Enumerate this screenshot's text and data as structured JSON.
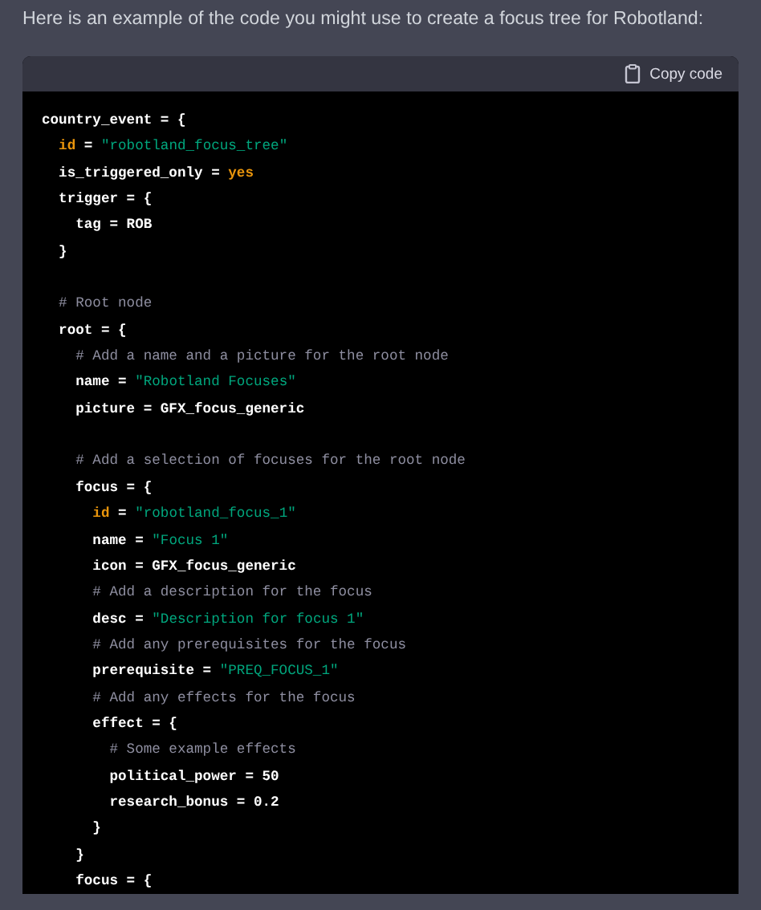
{
  "intro": "Here is an example of the code you might use to create a focus tree for Robotland:",
  "copy_button": "Copy code",
  "lines": [
    {
      "kind": "code",
      "segments": [
        {
          "kind": "plain",
          "text": "country_event = {"
        }
      ]
    },
    {
      "kind": "code",
      "segments": [
        {
          "kind": "key",
          "text": "  id"
        },
        {
          "kind": "plain",
          "text": " = "
        },
        {
          "kind": "string",
          "text": "\"robotland_focus_tree\""
        }
      ]
    },
    {
      "kind": "code",
      "segments": [
        {
          "kind": "plain",
          "text": "  is_triggered_only = "
        },
        {
          "kind": "keyword",
          "text": "yes"
        }
      ]
    },
    {
      "kind": "code",
      "segments": [
        {
          "kind": "plain",
          "text": "  trigger = {"
        }
      ]
    },
    {
      "kind": "code",
      "segments": [
        {
          "kind": "plain",
          "text": "    tag = ROB"
        }
      ]
    },
    {
      "kind": "code",
      "segments": [
        {
          "kind": "plain",
          "text": "  }"
        }
      ]
    },
    {
      "kind": "blank"
    },
    {
      "kind": "code",
      "segments": [
        {
          "kind": "comment",
          "text": "  # Root node"
        }
      ]
    },
    {
      "kind": "code",
      "segments": [
        {
          "kind": "plain",
          "text": "  root = {"
        }
      ]
    },
    {
      "kind": "code",
      "segments": [
        {
          "kind": "comment",
          "text": "    # Add a name and a picture for the root node"
        }
      ]
    },
    {
      "kind": "code",
      "segments": [
        {
          "kind": "plain",
          "text": "    name = "
        },
        {
          "kind": "string",
          "text": "\"Robotland Focuses\""
        }
      ]
    },
    {
      "kind": "code",
      "segments": [
        {
          "kind": "plain",
          "text": "    picture = GFX_focus_generic"
        }
      ]
    },
    {
      "kind": "blank"
    },
    {
      "kind": "code",
      "segments": [
        {
          "kind": "comment",
          "text": "    # Add a selection of focuses for the root node"
        }
      ]
    },
    {
      "kind": "code",
      "segments": [
        {
          "kind": "plain",
          "text": "    focus = {"
        }
      ]
    },
    {
      "kind": "code",
      "segments": [
        {
          "kind": "key",
          "text": "      id"
        },
        {
          "kind": "plain",
          "text": " = "
        },
        {
          "kind": "string",
          "text": "\"robotland_focus_1\""
        }
      ]
    },
    {
      "kind": "code",
      "segments": [
        {
          "kind": "plain",
          "text": "      name = "
        },
        {
          "kind": "string",
          "text": "\"Focus 1\""
        }
      ]
    },
    {
      "kind": "code",
      "segments": [
        {
          "kind": "plain",
          "text": "      icon = GFX_focus_generic"
        }
      ]
    },
    {
      "kind": "code",
      "segments": [
        {
          "kind": "comment",
          "text": "      # Add a description for the focus"
        }
      ]
    },
    {
      "kind": "code",
      "segments": [
        {
          "kind": "plain",
          "text": "      desc = "
        },
        {
          "kind": "string",
          "text": "\"Description for focus 1\""
        }
      ]
    },
    {
      "kind": "code",
      "segments": [
        {
          "kind": "comment",
          "text": "      # Add any prerequisites for the focus"
        }
      ]
    },
    {
      "kind": "code",
      "segments": [
        {
          "kind": "plain",
          "text": "      prerequisite = "
        },
        {
          "kind": "string",
          "text": "\"PREQ_FOCUS_1\""
        }
      ]
    },
    {
      "kind": "code",
      "segments": [
        {
          "kind": "comment",
          "text": "      # Add any effects for the focus"
        }
      ]
    },
    {
      "kind": "code",
      "segments": [
        {
          "kind": "plain",
          "text": "      effect = {"
        }
      ]
    },
    {
      "kind": "code",
      "segments": [
        {
          "kind": "comment",
          "text": "        # Some example effects"
        }
      ]
    },
    {
      "kind": "code",
      "segments": [
        {
          "kind": "plain",
          "text": "        political_power = 50"
        }
      ]
    },
    {
      "kind": "code",
      "segments": [
        {
          "kind": "plain",
          "text": "        research_bonus = 0.2"
        }
      ]
    },
    {
      "kind": "code",
      "segments": [
        {
          "kind": "plain",
          "text": "      }"
        }
      ]
    },
    {
      "kind": "code",
      "segments": [
        {
          "kind": "plain",
          "text": "    }"
        }
      ]
    },
    {
      "kind": "code",
      "segments": [
        {
          "kind": "plain",
          "text": "    focus = {"
        }
      ]
    }
  ]
}
